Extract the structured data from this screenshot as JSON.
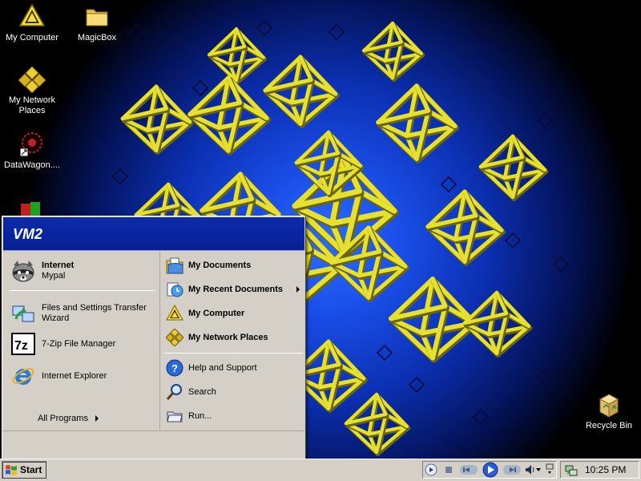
{
  "desktop": {
    "icons": [
      {
        "label": "My Computer",
        "icon": "my-computer-icon"
      },
      {
        "label": "MagicBox",
        "icon": "folder-icon"
      },
      {
        "label": "My Network Places",
        "icon": "network-places-icon"
      },
      {
        "label": "DataWagon....",
        "icon": "datawagon-icon"
      },
      {
        "label": "Recycle Bin",
        "icon": "recycle-bin-icon"
      }
    ]
  },
  "start_menu": {
    "user": "VM2",
    "left": {
      "internet_title": "Internet",
      "internet_sub": "Mypal",
      "fast_line1": "Files and Settings Transfer",
      "fast_line2": "Wizard",
      "sevenzip": "7-Zip File Manager",
      "ie": "Internet Explorer",
      "all_programs": "All Programs"
    },
    "right": {
      "items": [
        {
          "label": "My Documents",
          "icon": "my-documents-icon"
        },
        {
          "label": "My Recent Documents",
          "icon": "recent-documents-icon"
        },
        {
          "label": "My Computer",
          "icon": "my-computer-icon"
        },
        {
          "label": "My Network Places",
          "icon": "network-places-icon"
        },
        {
          "label": "Help and Support",
          "icon": "help-icon"
        },
        {
          "label": "Search",
          "icon": "search-icon"
        },
        {
          "label": "Run...",
          "icon": "run-icon"
        }
      ]
    }
  },
  "taskbar": {
    "start_label": "Start",
    "clock": "10:25 PM"
  },
  "colors": {
    "header_blue": "#0a24a0",
    "menu_gray": "#d4d0c8",
    "wallpaper_blue": "#1a4ee8",
    "octahedron_yellow": "#e6e030"
  }
}
